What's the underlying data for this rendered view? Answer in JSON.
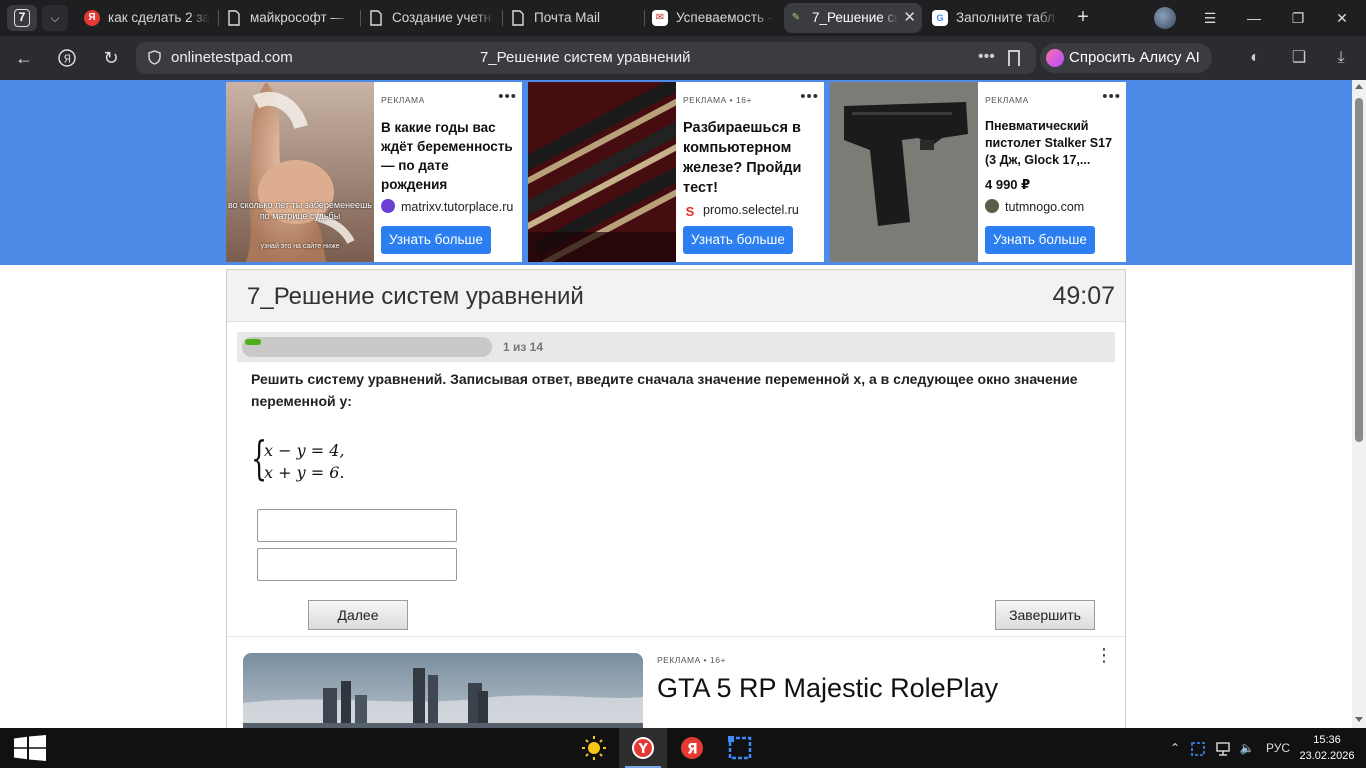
{
  "browser": {
    "tab_counter": "7",
    "tabs": [
      {
        "title": "как сделать 2 за",
        "favicon": "yandex-icon",
        "color": "#e53935"
      },
      {
        "title": "майкрософт — ",
        "favicon": "document-icon",
        "color": "#ffffff"
      },
      {
        "title": "Создание учетн",
        "favicon": "document-icon",
        "color": "#ffffff"
      },
      {
        "title": "Почта Mail",
        "favicon": "document-icon",
        "color": "#ffffff"
      },
      {
        "title": "Успеваемость - ",
        "favicon": "gradebook-icon",
        "color": "#ffffff"
      },
      {
        "title": "7_Решение си",
        "favicon": "test-icon",
        "color": "#ffffff",
        "active": true
      },
      {
        "title": "Заполните табл",
        "favicon": "google-docs-icon",
        "color": "#ffffff"
      }
    ],
    "address": {
      "domain": "onlinetestpad.com",
      "page_title": "7_Решение систем уравнений"
    },
    "alice_button": "Спросить Алису AI"
  },
  "ads": [
    {
      "label": "РЕКЛАМА",
      "headline": "В какие годы вас ждёт беременность — по дате рождения",
      "domain": "matrixv.tutorplace.ru",
      "cta": "Узнать больше",
      "image_caption": "во сколько лет ты забеременеешь по матрице судьбы",
      "image_subcaption": "узнай это на сайте ниже"
    },
    {
      "label": "РЕКЛАМА • 16+",
      "headline": "Разбираешься в компьютерном железе? Пройди тест!",
      "domain": "promo.selectel.ru",
      "cta": "Узнать больше"
    },
    {
      "label": "РЕКЛАМА",
      "headline": "Пневматический пистолет Stalker S17 (3 Дж, Glock 17,...",
      "price": "4 990 ₽",
      "domain": "tutmnogo.com",
      "cta": "Узнать больше"
    }
  ],
  "test": {
    "title": "7_Решение систем уравнений",
    "timer": "49:07",
    "progress_text": "1 из 14",
    "progress_fraction": 0.0714,
    "question": "Решить систему уравнений. Записывая ответ, введите сначала значение переменной x, а в следующее окно значение переменной y:",
    "equations": [
      "x − y = 4,",
      "x + y = 6."
    ],
    "answer_x": "",
    "answer_y": "",
    "next_button": "Далее",
    "finish_button": "Завершить"
  },
  "bottom_ad": {
    "label": "РЕКЛАМА • 16+",
    "title": "GTA 5 RP Majestic RolePlay"
  },
  "taskbar": {
    "language": "РУС",
    "time": "15:36",
    "date": "23.02.2026"
  },
  "colors": {
    "ad_band": "#4c8ce8",
    "cta_blue": "#2b7ff0",
    "progress_green": "#4caf1a"
  }
}
